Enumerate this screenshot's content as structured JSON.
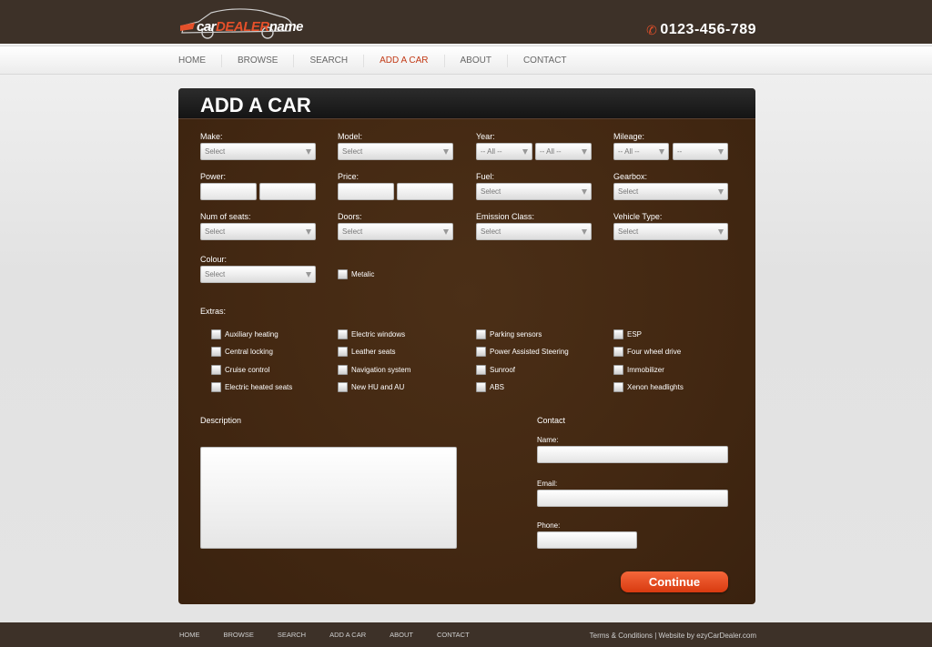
{
  "header": {
    "logo_main": "car",
    "logo_accent": "DEALER",
    "logo_suffix": "name",
    "phone": "0123-456-789"
  },
  "nav": [
    "HOME",
    "BROWSE",
    "SEARCH",
    "ADD A CAR",
    "ABOUT",
    "CONTACT"
  ],
  "page_title": "ADD A CAR",
  "form": {
    "make": {
      "label": "Make:",
      "value": "Select"
    },
    "model": {
      "label": "Model:",
      "value": "Select"
    },
    "year": {
      "label": "Year:",
      "from": "-- All --",
      "to": "-- All --"
    },
    "mileage": {
      "label": "Mileage:",
      "from": "-- All --",
      "to": "--"
    },
    "power": {
      "label": "Power:"
    },
    "price": {
      "label": "Price:"
    },
    "fuel": {
      "label": "Fuel:",
      "value": "Select"
    },
    "gearbox": {
      "label": "Gearbox:",
      "value": "Select"
    },
    "seats": {
      "label": "Num of seats:",
      "value": "Select"
    },
    "doors": {
      "label": "Doors:",
      "value": "Select"
    },
    "emission": {
      "label": "Emission Class:",
      "value": "Select"
    },
    "vehicle_type": {
      "label": "Vehicle Type:",
      "value": "Select"
    },
    "colour": {
      "label": "Colour:",
      "value": "Select"
    },
    "metalic": "Metalic"
  },
  "extras_title": "Extras:",
  "extras": [
    [
      "Auxiliary heating",
      "Central locking",
      "Cruise control",
      "Electric heated seats"
    ],
    [
      "Electric windows",
      "Leather seats",
      "Navigation system",
      "New HU and AU"
    ],
    [
      "Parking sensors",
      "Power Assisted Steering",
      "Sunroof",
      "ABS"
    ],
    [
      "ESP",
      "Four wheel drive",
      "Immobilizer",
      "Xenon headlights"
    ]
  ],
  "description_title": "Description",
  "contact": {
    "title": "Contact",
    "name_label": "Name:",
    "email_label": "Email:",
    "phone_label": "Phone:"
  },
  "continue_label": "Continue",
  "footer": {
    "nav": [
      "HOME",
      "BROWSE",
      "SEARCH",
      "ADD A CAR",
      "ABOUT",
      "CONTACT"
    ],
    "terms": "Terms & Conditions",
    "separator": " | ",
    "credit": "Website by ezyCarDealer.com"
  },
  "colors": {
    "brand": "#3d3128",
    "accent": "#e5502a",
    "panel": "#432812"
  }
}
